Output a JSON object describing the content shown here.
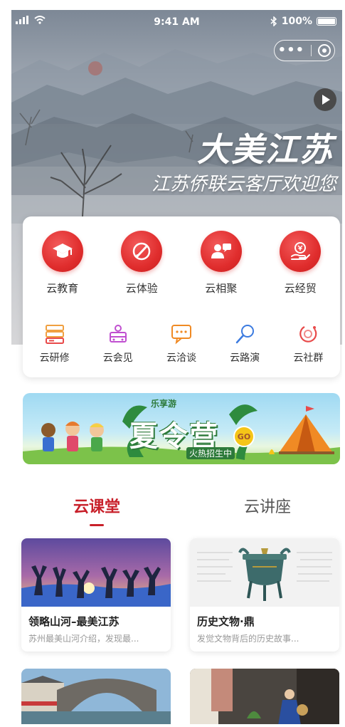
{
  "status_bar": {
    "time": "9:41 AM",
    "battery": "100%"
  },
  "capsule": {
    "more": "•••"
  },
  "hero": {
    "title": "大美江苏",
    "subtitle": "江苏侨联云客厅欢迎您"
  },
  "menu": {
    "primary": [
      {
        "label": "云教育",
        "icon": "graduation-cap-icon"
      },
      {
        "label": "云体验",
        "icon": "brush-icon"
      },
      {
        "label": "云相聚",
        "icon": "people-chat-icon"
      },
      {
        "label": "云经贸",
        "icon": "yen-hand-icon"
      }
    ],
    "secondary": [
      {
        "label": "云研修",
        "icon": "layers-icon",
        "color": "#f0a040"
      },
      {
        "label": "云会见",
        "icon": "meeting-icon",
        "color": "#c04fd0"
      },
      {
        "label": "云洽谈",
        "icon": "chat-icon",
        "color": "#f08a24"
      },
      {
        "label": "云路演",
        "icon": "microphone-icon",
        "color": "#3c7be0"
      },
      {
        "label": "云社群",
        "icon": "community-icon",
        "color": "#e84a4a"
      }
    ]
  },
  "banner": {
    "top": "乐享游",
    "title": "夏令营",
    "subtitle": "火热招生中",
    "go": "GO"
  },
  "tabs": [
    {
      "label": "云课堂",
      "active": true
    },
    {
      "label": "云讲座",
      "active": false
    }
  ],
  "courses": [
    {
      "title": "领略山河–最美江苏",
      "desc": "苏州最美山河介绍，发现最..."
    },
    {
      "title": "历史文物·鼎",
      "desc": "发觉文物背后的历史故事..."
    }
  ]
}
